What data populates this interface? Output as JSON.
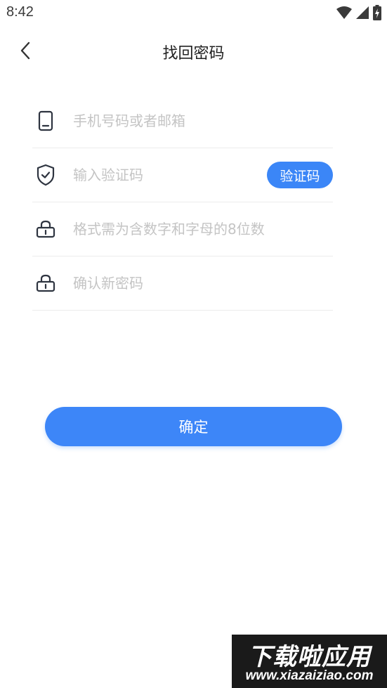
{
  "status_bar": {
    "time": "8:42",
    "icons": [
      "wifi-icon",
      "signal-icon",
      "battery-charging-icon"
    ]
  },
  "header": {
    "back_icon": "chevron-left-icon",
    "title": "找回密码"
  },
  "form": {
    "account": {
      "icon": "phone-icon",
      "placeholder": "手机号码或者邮箱",
      "value": ""
    },
    "code": {
      "icon": "shield-check-icon",
      "placeholder": "输入验证码",
      "value": "",
      "button_label": "验证码"
    },
    "password": {
      "icon": "lock-icon",
      "placeholder": "格式需为含数字和字母的8位数",
      "value": ""
    },
    "confirm_password": {
      "icon": "lock-icon",
      "placeholder": "确认新密码",
      "value": ""
    }
  },
  "confirm_button": {
    "label": "确定"
  },
  "watermark": {
    "main": "下载啦应用",
    "sub": "www.xiazaiziao.com"
  },
  "colors": {
    "accent": "#3b86f7",
    "placeholder": "#c4c4c4",
    "divider": "#ececec",
    "title": "#222222"
  }
}
